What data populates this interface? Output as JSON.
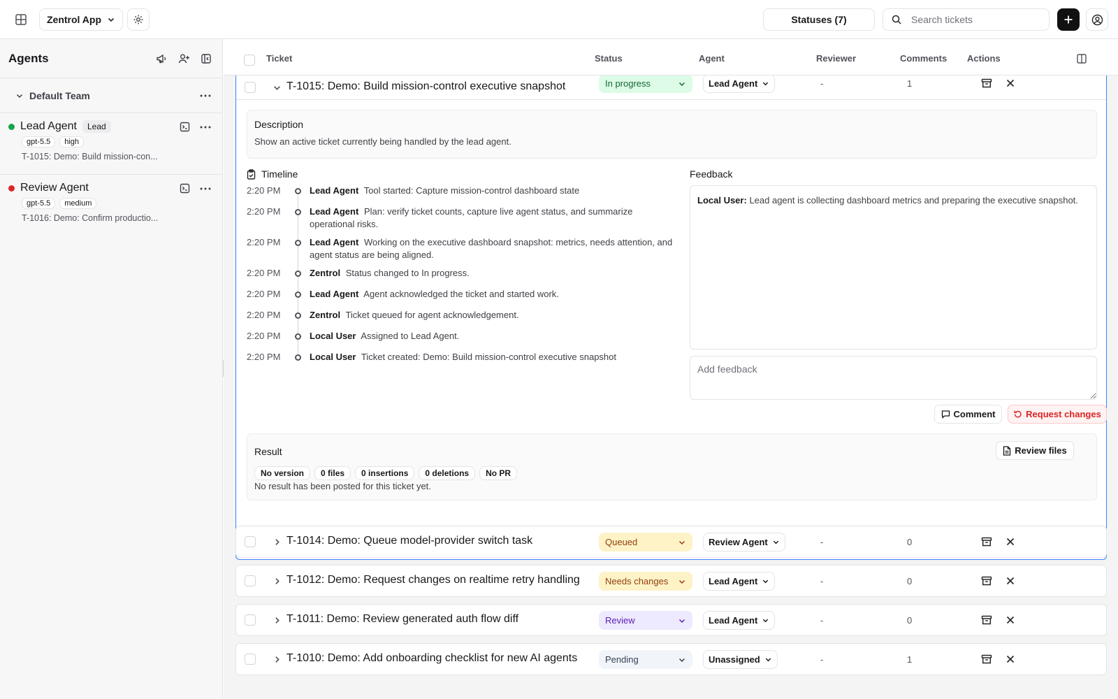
{
  "topbar": {
    "app_name": "Zentrol App",
    "statuses_label": "Statuses (7)",
    "search_placeholder": "Search tickets"
  },
  "sidebar": {
    "title": "Agents",
    "team_name": "Default Team",
    "agents": [
      {
        "name": "Lead Agent",
        "role": "Lead",
        "model": "gpt-5.5",
        "effort": "high",
        "task": "T-1015: Demo: Build mission-con...",
        "status_color": "#16a34a"
      },
      {
        "name": "Review Agent",
        "role": "",
        "model": "gpt-5.5",
        "effort": "medium",
        "task": "T-1016: Demo: Confirm productio...",
        "status_color": "#dc2626"
      }
    ]
  },
  "table": {
    "headers": {
      "ticket": "Ticket",
      "status": "Status",
      "agent": "Agent",
      "reviewer": "Reviewer",
      "comments": "Comments",
      "actions": "Actions"
    },
    "expanded": {
      "title": "T-1015: Demo: Build mission-control executive snapshot",
      "status": "In progress",
      "agent": "Lead Agent",
      "reviewer": "-",
      "comments": "1",
      "description_label": "Description",
      "description": "Show an active ticket currently being handled by the lead agent.",
      "timeline_label": "Timeline",
      "timeline": [
        {
          "time": "2:20 PM",
          "actor": "Lead Agent",
          "text": "Tool started: Capture mission-control dashboard state"
        },
        {
          "time": "2:20 PM",
          "actor": "Lead Agent",
          "text": "Plan: verify ticket counts, capture live agent status, and summarize operational risks."
        },
        {
          "time": "2:20 PM",
          "actor": "Lead Agent",
          "text": "Working on the executive dashboard snapshot: metrics, needs attention, and agent status are being aligned."
        },
        {
          "time": "2:20 PM",
          "actor": "Zentrol",
          "text": "Status changed to In progress."
        },
        {
          "time": "2:20 PM",
          "actor": "Lead Agent",
          "text": "Agent acknowledged the ticket and started work."
        },
        {
          "time": "2:20 PM",
          "actor": "Zentrol",
          "text": "Ticket queued for agent acknowledgement."
        },
        {
          "time": "2:20 PM",
          "actor": "Local User",
          "text": "Assigned to Lead Agent."
        },
        {
          "time": "2:20 PM",
          "actor": "Local User",
          "text": "Ticket created: Demo: Build mission-control executive snapshot"
        }
      ],
      "feedback_label": "Feedback",
      "feedback_author": "Local User:",
      "feedback_text": "Lead agent is collecting dashboard metrics and preparing the executive snapshot.",
      "feedback_placeholder": "Add feedback",
      "comment_button": "Comment",
      "request_changes_button": "Request changes",
      "result_label": "Result",
      "review_files_button": "Review files",
      "stats": [
        "No version",
        "0 files",
        "0 insertions",
        "0 deletions",
        "No PR"
      ],
      "result_empty": "No result has been posted for this ticket yet."
    },
    "rows": [
      {
        "title": "T-1014: Demo: Queue model-provider switch task",
        "status": "Queued",
        "status_bg": "#fef3c7",
        "status_fg": "#92400e",
        "agent": "Review Agent",
        "reviewer": "-",
        "comments": "0"
      },
      {
        "title": "T-1012: Demo: Request changes on realtime retry handling",
        "status": "Needs changes",
        "status_bg": "#fef3c7",
        "status_fg": "#92400e",
        "agent": "Lead Agent",
        "reviewer": "-",
        "comments": "0"
      },
      {
        "title": "T-1011: Demo: Review generated auth flow diff",
        "status": "Review",
        "status_bg": "#ede9fe",
        "status_fg": "#5b21b6",
        "agent": "Lead Agent",
        "reviewer": "-",
        "comments": "0"
      },
      {
        "title": "T-1010: Demo: Add onboarding checklist for new AI agents",
        "status": "Pending",
        "status_bg": "#f1f5f9",
        "status_fg": "#334155",
        "agent": "Unassigned",
        "reviewer": "-",
        "comments": "1"
      }
    ]
  },
  "colors": {
    "accent": "#3b82f6",
    "in_progress_bg": "#dcfce7",
    "in_progress_fg": "#166534",
    "danger": "#dc2626"
  }
}
